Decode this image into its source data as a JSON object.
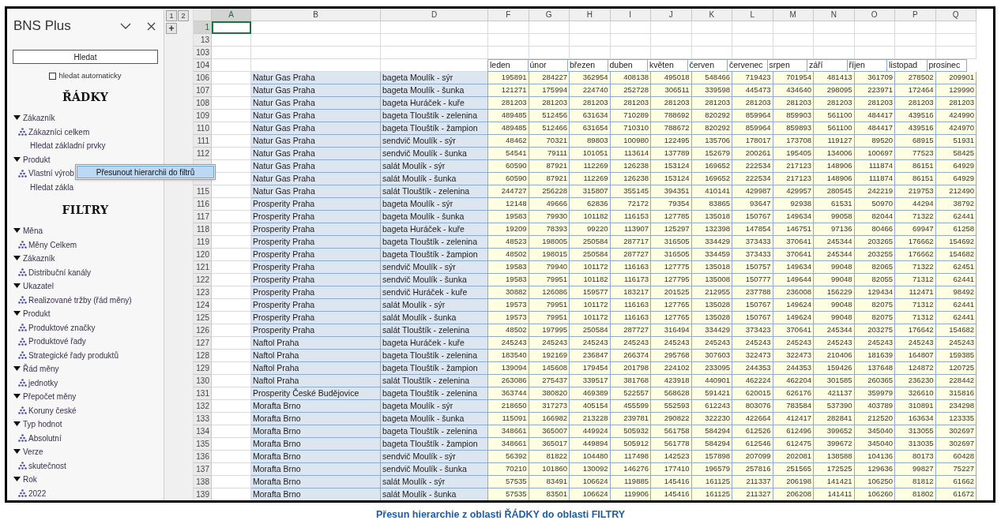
{
  "panel": {
    "title": "BNS Plus",
    "search_button": "Hledat",
    "auto_search": {
      "label": "hledat automaticky",
      "checked": false
    },
    "sections": [
      {
        "heading": "ŘÁDKY",
        "groups": [
          {
            "label": "Zákazník",
            "expanded": true,
            "children": [
              {
                "label": "Zákazníci celkem",
                "kind": "hierarchy"
              },
              {
                "label": "Hledat základní prvky",
                "kind": "search"
              }
            ]
          },
          {
            "label": "Produkt",
            "expanded": true,
            "children": [
              {
                "label": "Vlastní výrob",
                "kind": "hierarchy"
              },
              {
                "label": "Hledat zákla",
                "kind": "search"
              }
            ]
          }
        ]
      },
      {
        "heading": "FILTRY",
        "groups": [
          {
            "label": "Měna",
            "expanded": true,
            "children": [
              {
                "label": "Měny Celkem",
                "kind": "hierarchy"
              }
            ]
          },
          {
            "label": "Zákazník",
            "expanded": true,
            "children": [
              {
                "label": "Distribuční kanály",
                "kind": "hierarchy"
              }
            ]
          },
          {
            "label": "Ukazatel",
            "expanded": true,
            "children": [
              {
                "label": "Realizované tržby (řád měny)",
                "kind": "hierarchy"
              }
            ]
          },
          {
            "label": "Produkt",
            "expanded": true,
            "children": [
              {
                "label": "Produktové značky",
                "kind": "hierarchy"
              },
              {
                "label": "Produktové řady",
                "kind": "hierarchy"
              },
              {
                "label": "Strategické řady produktů",
                "kind": "hierarchy"
              }
            ]
          },
          {
            "label": "Řád měny",
            "expanded": true,
            "children": [
              {
                "label": "jednotky",
                "kind": "hierarchy"
              }
            ]
          },
          {
            "label": "Přepočet měny",
            "expanded": true,
            "children": [
              {
                "label": "Koruny české",
                "kind": "hierarchy"
              }
            ]
          },
          {
            "label": "Typ hodnot",
            "expanded": true,
            "children": [
              {
                "label": "Absolutní",
                "kind": "hierarchy"
              }
            ]
          },
          {
            "label": "Verze",
            "expanded": true,
            "children": [
              {
                "label": "skutečnost",
                "kind": "hierarchy"
              }
            ]
          },
          {
            "label": "Rok",
            "expanded": true,
            "children": [
              {
                "label": "2022",
                "kind": "hierarchy"
              }
            ]
          }
        ]
      }
    ]
  },
  "context_menu": {
    "items": [
      {
        "label": "Přesunout hierarchii do filtrů",
        "selected": true
      }
    ]
  },
  "sheet": {
    "outline_levels": [
      "1",
      "2"
    ],
    "expand_button": "+",
    "columns": [
      {
        "letter": "A",
        "selected": true
      },
      {
        "letter": "B",
        "selected": false
      },
      {
        "letter": "D",
        "selected": false
      },
      {
        "letter": "F",
        "selected": false
      },
      {
        "letter": "G",
        "selected": false
      },
      {
        "letter": "H",
        "selected": false
      },
      {
        "letter": "I",
        "selected": false
      },
      {
        "letter": "J",
        "selected": false
      },
      {
        "letter": "K",
        "selected": false
      },
      {
        "letter": "L",
        "selected": false
      },
      {
        "letter": "M",
        "selected": false
      },
      {
        "letter": "N",
        "selected": false
      },
      {
        "letter": "O",
        "selected": false
      },
      {
        "letter": "P",
        "selected": false
      },
      {
        "letter": "Q",
        "selected": false
      }
    ],
    "empty_rows": [
      {
        "num": "1",
        "selected": true
      },
      {
        "num": "13",
        "selected": false
      },
      {
        "num": "103",
        "selected": false
      }
    ],
    "month_row": {
      "num": "104",
      "months": [
        "leden",
        "únor",
        "březen",
        "duben",
        "květen",
        "červen",
        "červenec",
        "srpen",
        "září",
        "říjen",
        "listopad",
        "prosinec"
      ]
    },
    "rows": [
      {
        "num": "106",
        "customer": "Natur Gas Praha",
        "product": "bageta Moulík - sýr",
        "values": [
          "195891",
          "284227",
          "362954",
          "408138",
          "495018",
          "548466",
          "719423",
          "701954",
          "481413",
          "361709",
          "278502",
          "209901"
        ]
      },
      {
        "num": "107",
        "customer": "Natur Gas Praha",
        "product": "bageta Moulík - šunka",
        "values": [
          "121271",
          "175994",
          "224740",
          "252728",
          "306511",
          "339598",
          "445473",
          "434640",
          "298095",
          "223971",
          "172464",
          "129990"
        ]
      },
      {
        "num": "108",
        "customer": "Natur Gas Praha",
        "product": "bageta Huráček - kuře",
        "values": [
          "281203",
          "281203",
          "281203",
          "281203",
          "281203",
          "281203",
          "281203",
          "281203",
          "281203",
          "281203",
          "281203",
          "281203"
        ]
      },
      {
        "num": "109",
        "customer": "Natur Gas Praha",
        "product": "bageta Tlouštík - zelenina",
        "values": [
          "489485",
          "512456",
          "631634",
          "710289",
          "788692",
          "820292",
          "859964",
          "859903",
          "561100",
          "484417",
          "439516",
          "424990"
        ]
      },
      {
        "num": "110",
        "customer": "Natur Gas Praha",
        "product": "bageta Tlouštík - žampion",
        "values": [
          "489485",
          "512466",
          "631654",
          "710310",
          "788672",
          "820292",
          "859964",
          "859893",
          "561100",
          "484417",
          "439516",
          "424970"
        ]
      },
      {
        "num": "111",
        "customer": "Natur Gas Praha",
        "product": "sendvič Moulík - sýr",
        "values": [
          "48462",
          "70321",
          "89803",
          "100980",
          "122495",
          "135706",
          "178017",
          "173708",
          "119127",
          "89520",
          "68915",
          "51931"
        ]
      },
      {
        "num": "112",
        "customer": "Natur Gas Praha",
        "product": "sendvič Moulík - šunka",
        "values": [
          "54541",
          "79111",
          "101051",
          "113614",
          "137789",
          "152679",
          "200261",
          "195405",
          "134006",
          "100697",
          "77523",
          "58425"
        ]
      },
      {
        "customer": "Natur Gas Praha",
        "product": "salát Moulík - sýr",
        "values": [
          "60590",
          "87921",
          "112269",
          "126238",
          "153124",
          "169652",
          "222534",
          "217123",
          "148906",
          "111874",
          "86151",
          "64929"
        ]
      },
      {
        "customer": "Natur Gas Praha",
        "product": "salát Moulík - šunka",
        "values": [
          "60590",
          "87921",
          "112269",
          "126238",
          "153124",
          "169652",
          "222534",
          "217123",
          "148906",
          "111874",
          "86151",
          "64929"
        ]
      },
      {
        "num": "115",
        "customer": "Natur Gas Praha",
        "product": "salát Tlouštík - zelenina",
        "values": [
          "244727",
          "256228",
          "315807",
          "355145",
          "394351",
          "410141",
          "429987",
          "429957",
          "280545",
          "242219",
          "219753",
          "212490"
        ]
      },
      {
        "num": "116",
        "customer": "Prosperity Praha",
        "product": "bageta Moulík - sýr",
        "values": [
          "12148",
          "49666",
          "62836",
          "72172",
          "79354",
          "83865",
          "93647",
          "92938",
          "61531",
          "50970",
          "44294",
          "38792"
        ]
      },
      {
        "num": "117",
        "customer": "Prosperity Praha",
        "product": "bageta Moulík - šunka",
        "values": [
          "19583",
          "79930",
          "101182",
          "116153",
          "127785",
          "135018",
          "150767",
          "149634",
          "99058",
          "82044",
          "71322",
          "62441"
        ]
      },
      {
        "num": "118",
        "customer": "Prosperity Praha",
        "product": "bageta Huráček - kuře",
        "values": [
          "19209",
          "78393",
          "99220",
          "113907",
          "125297",
          "132398",
          "147854",
          "146751",
          "97136",
          "80466",
          "69947",
          "61258"
        ]
      },
      {
        "num": "119",
        "customer": "Prosperity Praha",
        "product": "bageta Tlouštík - zelenina",
        "values": [
          "48523",
          "198005",
          "250584",
          "287717",
          "316505",
          "334429",
          "373433",
          "370641",
          "245344",
          "203265",
          "176662",
          "154692"
        ]
      },
      {
        "num": "120",
        "customer": "Prosperity Praha",
        "product": "bageta Tlouštík - žampion",
        "values": [
          "48502",
          "198015",
          "250584",
          "287727",
          "316505",
          "334459",
          "373433",
          "370641",
          "245344",
          "203255",
          "176662",
          "154682"
        ]
      },
      {
        "num": "121",
        "customer": "Prosperity Praha",
        "product": "sendvič Moulík - sýr",
        "values": [
          "19583",
          "79940",
          "101172",
          "116163",
          "127775",
          "135018",
          "150757",
          "149634",
          "99048",
          "82065",
          "71322",
          "62451"
        ]
      },
      {
        "num": "122",
        "customer": "Prosperity Praha",
        "product": "sendvič Moulík - šunka",
        "values": [
          "19583",
          "79951",
          "101182",
          "116173",
          "127795",
          "135008",
          "150777",
          "149644",
          "99048",
          "82055",
          "71312",
          "62441"
        ]
      },
      {
        "num": "123",
        "customer": "Prosperity Praha",
        "product": "sendvič Huráček - kuře",
        "values": [
          "30882",
          "126086",
          "159577",
          "183217",
          "201525",
          "212955",
          "237788",
          "236008",
          "156229",
          "129434",
          "112471",
          "98492"
        ]
      },
      {
        "num": "124",
        "customer": "Prosperity Praha",
        "product": "salát Moulík - sýr",
        "values": [
          "19573",
          "79951",
          "101172",
          "116163",
          "127765",
          "135028",
          "150767",
          "149624",
          "99048",
          "82075",
          "71312",
          "62441"
        ]
      },
      {
        "num": "125",
        "customer": "Prosperity Praha",
        "product": "salát Moulík - šunka",
        "values": [
          "19573",
          "79951",
          "101172",
          "116163",
          "127765",
          "135028",
          "150767",
          "149624",
          "99048",
          "82075",
          "71312",
          "62441"
        ]
      },
      {
        "num": "126",
        "customer": "Prosperity Praha",
        "product": "salát Tlouštík - zelenina",
        "values": [
          "48502",
          "197995",
          "250584",
          "287727",
          "316494",
          "334429",
          "373423",
          "370641",
          "245344",
          "203275",
          "176642",
          "154682"
        ]
      },
      {
        "num": "127",
        "customer": "Naftol Praha",
        "product": "bageta Huráček - kuře",
        "values": [
          "245243",
          "245243",
          "245243",
          "245243",
          "245243",
          "245243",
          "245243",
          "245243",
          "245243",
          "245243",
          "245243",
          "245243"
        ]
      },
      {
        "num": "128",
        "customer": "Naftol Praha",
        "product": "bageta Tlouštík - zelenina",
        "values": [
          "183540",
          "192169",
          "236847",
          "266374",
          "295768",
          "307603",
          "322473",
          "322473",
          "210406",
          "181639",
          "164807",
          "159385"
        ]
      },
      {
        "num": "129",
        "customer": "Naftol Praha",
        "product": "bageta Tlouštík - žampion",
        "values": [
          "139094",
          "145608",
          "179454",
          "201798",
          "224102",
          "233095",
          "244353",
          "244353",
          "159426",
          "137648",
          "124872",
          "120725"
        ]
      },
      {
        "num": "130",
        "customer": "Naftol Praha",
        "product": "salát Tlouštík - zelenina",
        "values": [
          "263086",
          "275437",
          "339517",
          "381768",
          "423918",
          "440901",
          "462224",
          "462204",
          "301585",
          "260365",
          "236230",
          "228442"
        ]
      },
      {
        "num": "131",
        "customer": "Prosperity České Budějovice",
        "product": "bageta Tlouštík - zelenina",
        "values": [
          "363744",
          "380820",
          "469389",
          "522557",
          "568628",
          "591421",
          "620015",
          "626176",
          "421137",
          "359979",
          "326610",
          "315816"
        ]
      },
      {
        "num": "132",
        "customer": "Morafta Brno",
        "product": "bageta Moulík - sýr",
        "values": [
          "218650",
          "317273",
          "405154",
          "455599",
          "552593",
          "612243",
          "803076",
          "783584",
          "537390",
          "403789",
          "310891",
          "234298"
        ]
      },
      {
        "num": "133",
        "customer": "Morafta Brno",
        "product": "bageta Moulík - šunka",
        "values": [
          "115091",
          "166982",
          "213228",
          "239781",
          "290822",
          "322230",
          "422664",
          "412417",
          "282841",
          "212520",
          "163634",
          "123335"
        ]
      },
      {
        "num": "134",
        "customer": "Morafta Brno",
        "product": "bageta Tlouštík - zelenina",
        "values": [
          "348661",
          "365007",
          "449924",
          "505932",
          "561758",
          "584294",
          "612526",
          "612496",
          "399652",
          "345040",
          "313055",
          "302697"
        ]
      },
      {
        "num": "135",
        "customer": "Morafta Brno",
        "product": "bageta Tlouštík - žampion",
        "values": [
          "348661",
          "365017",
          "449894",
          "505912",
          "561778",
          "584294",
          "612546",
          "612475",
          "399672",
          "345040",
          "313035",
          "302697"
        ]
      },
      {
        "num": "136",
        "customer": "Morafta Brno",
        "product": "sendvič Moulík - sýr",
        "values": [
          "56392",
          "81822",
          "104480",
          "117498",
          "142523",
          "157898",
          "207099",
          "202081",
          "138588",
          "104136",
          "80173",
          "60428"
        ]
      },
      {
        "num": "137",
        "customer": "Morafta Brno",
        "product": "sendvič Moulík - šunka",
        "values": [
          "70210",
          "101860",
          "130092",
          "146276",
          "177410",
          "196579",
          "257816",
          "251565",
          "172525",
          "129636",
          "99827",
          "75227"
        ]
      },
      {
        "num": "138",
        "customer": "Morafta Brno",
        "product": "salát Moulík - sýr",
        "values": [
          "57535",
          "83491",
          "106624",
          "119885",
          "145416",
          "161125",
          "211337",
          "206198",
          "141421",
          "106250",
          "81812",
          "61662"
        ]
      },
      {
        "num": "139",
        "customer": "Morafta Brno",
        "product": "salát Moulík - šunka",
        "values": [
          "57535",
          "83501",
          "106624",
          "119906",
          "145416",
          "161125",
          "211327",
          "206208",
          "141411",
          "106260",
          "81802",
          "61672"
        ]
      }
    ]
  },
  "caption": "Přesun hierarchie z oblasti ŘÁDKY do oblasti FILTRY"
}
